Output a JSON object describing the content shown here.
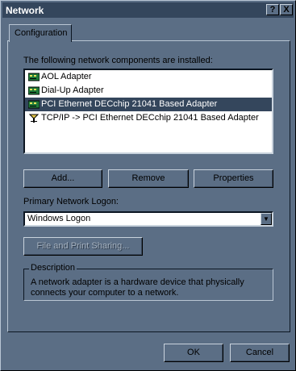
{
  "window": {
    "title": "Network",
    "help_label": "?",
    "close_label": "X"
  },
  "tabs": [
    {
      "label": "Configuration"
    }
  ],
  "components": {
    "label": "The following network components are installed:",
    "items": [
      {
        "label": "AOL Adapter",
        "icon": "network-adapter-icon",
        "selected": false
      },
      {
        "label": "Dial-Up Adapter",
        "icon": "network-adapter-icon",
        "selected": false
      },
      {
        "label": "PCI Ethernet DECchip 21041 Based Adapter",
        "icon": "network-adapter-icon",
        "selected": true
      },
      {
        "label": "TCP/IP -> PCI Ethernet DECchip 21041 Based Adapter",
        "icon": "protocol-icon",
        "selected": false
      }
    ]
  },
  "buttons": {
    "add": "Add...",
    "remove": "Remove",
    "properties": "Properties",
    "file_print_sharing": "File and Print Sharing...",
    "ok": "OK",
    "cancel": "Cancel"
  },
  "logon": {
    "label": "Primary Network Logon:",
    "value": "Windows Logon"
  },
  "description": {
    "legend": "Description",
    "text": "A network adapter is a hardware device that physically connects your computer to a network."
  },
  "colors": {
    "face": "#5b6e85",
    "titlebar": "#34465c",
    "selection": "#34465c",
    "disabled_text": "#a7b3c1"
  }
}
